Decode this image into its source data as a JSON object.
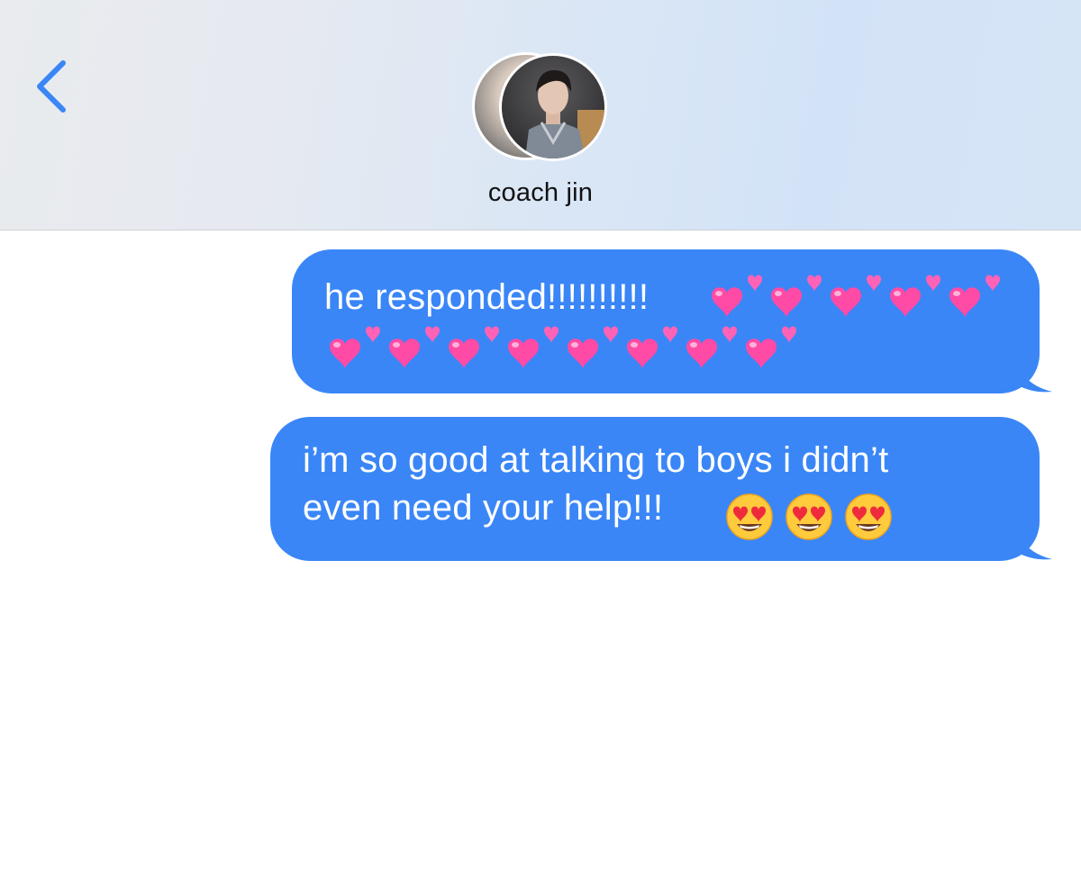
{
  "header": {
    "back_icon": "chevron-left-icon",
    "contact_name": "coach jin",
    "accent_color": "#3a86f7"
  },
  "messages": [
    {
      "sender": "me",
      "text": "he responded!!!!!!!!!!",
      "emoji": [
        "two-hearts",
        "two-hearts",
        "two-hearts",
        "two-hearts",
        "two-hearts",
        "two-hearts",
        "two-hearts",
        "two-hearts",
        "two-hearts",
        "two-hearts",
        "two-hearts",
        "two-hearts",
        "two-hearts"
      ]
    },
    {
      "sender": "me",
      "text": "i’m so good at talking to boys i didn’t\neven need your help!!!",
      "emoji": [
        "heart-eyes-face",
        "heart-eyes-face",
        "heart-eyes-face"
      ]
    }
  ],
  "bubble_color": "#3a86f7"
}
